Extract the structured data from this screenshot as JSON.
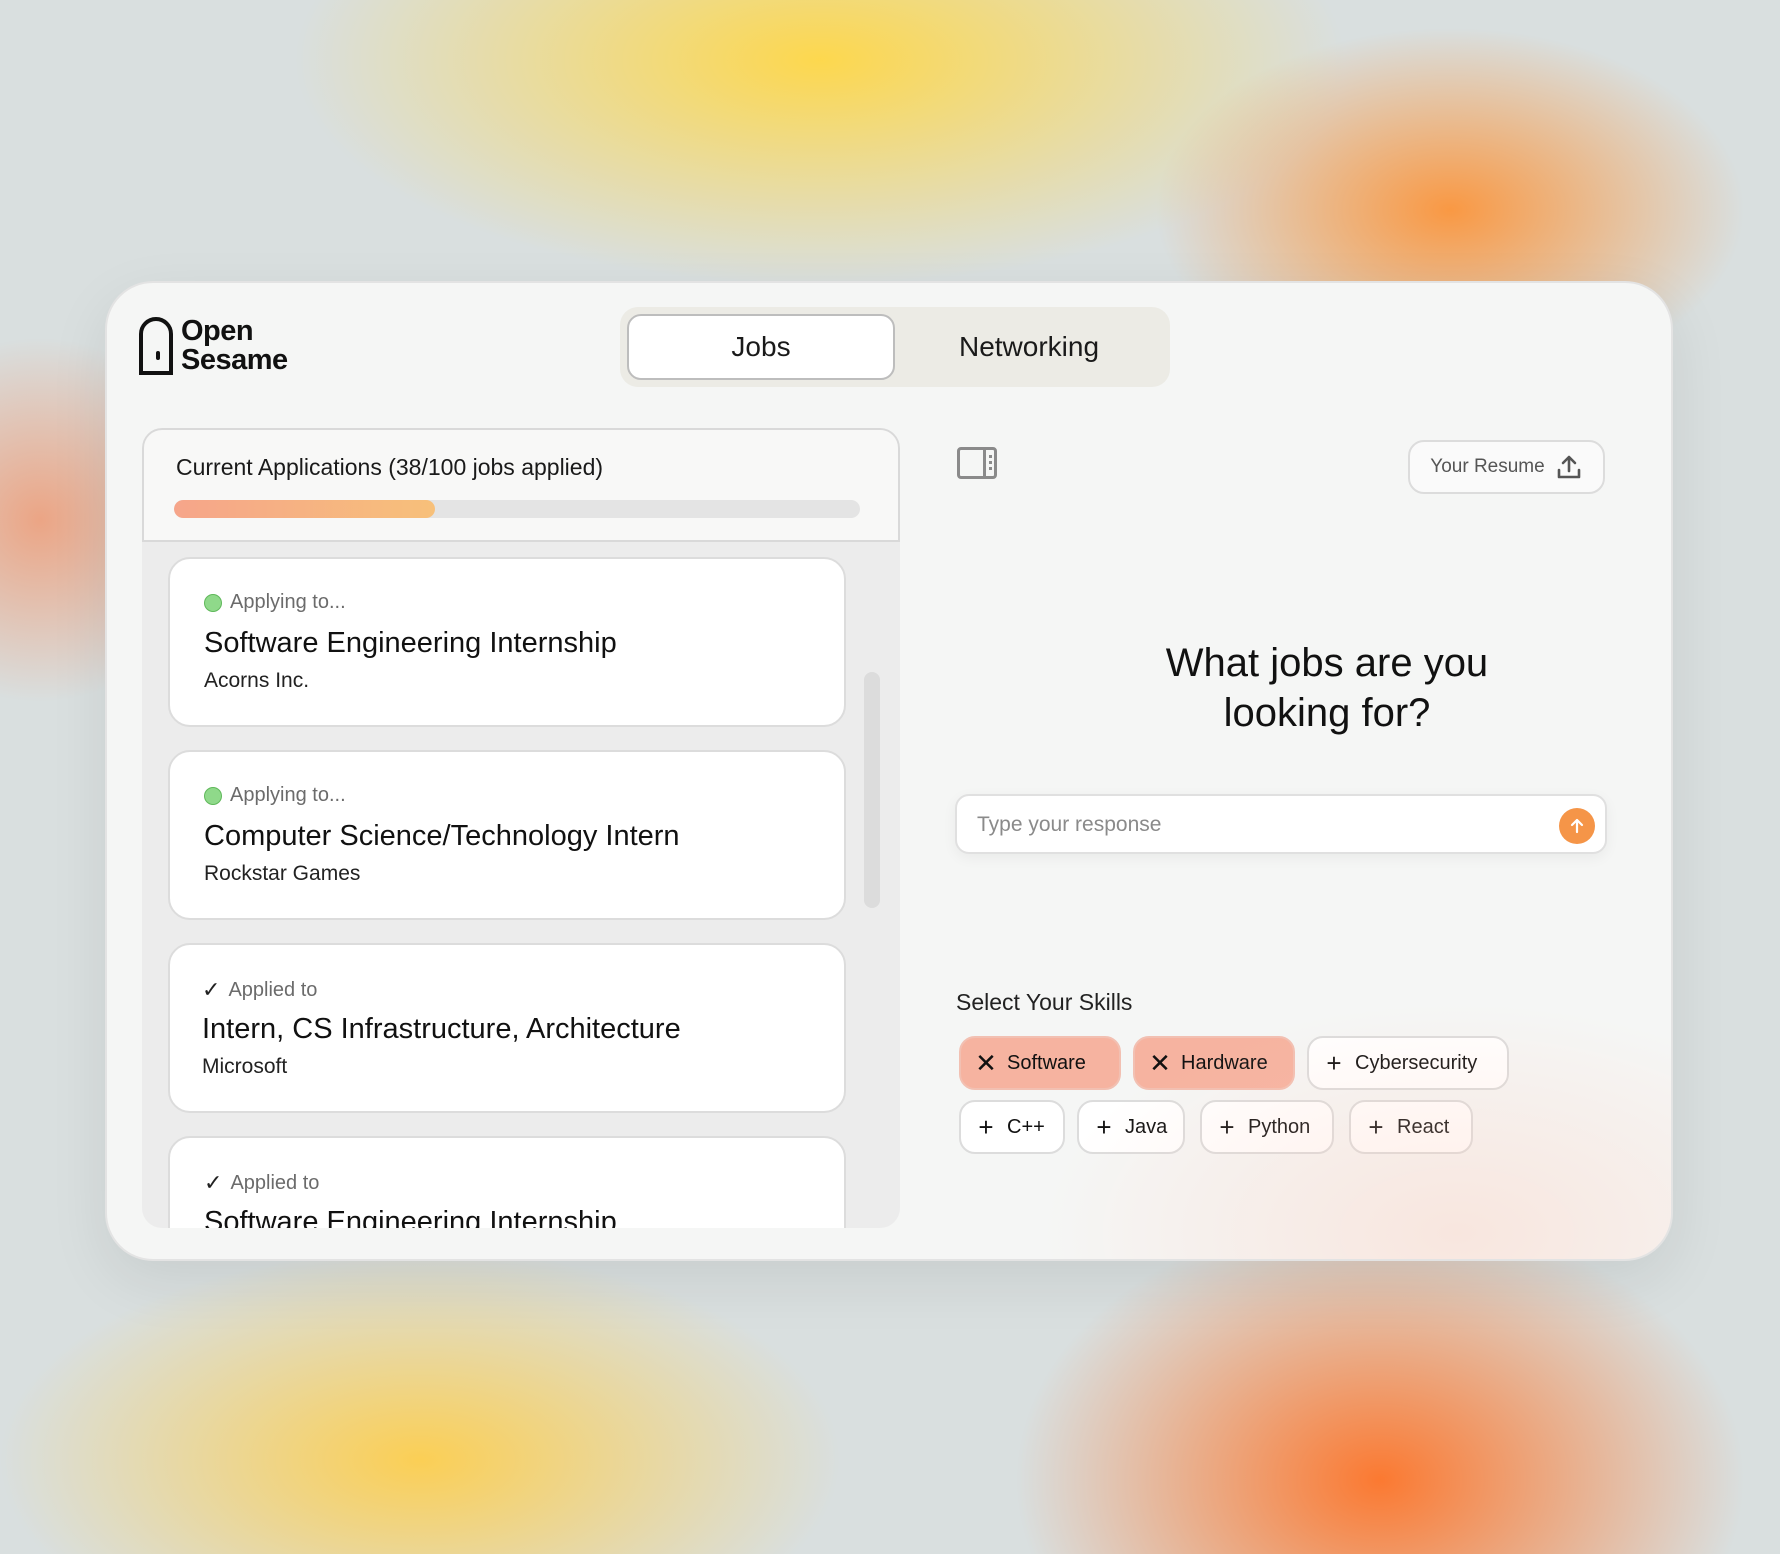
{
  "app": {
    "logo_line1": "Open",
    "logo_line2": "Sesame"
  },
  "tabs": [
    {
      "label": "Jobs",
      "active": true
    },
    {
      "label": "Networking",
      "active": false
    }
  ],
  "applications": {
    "title": "Current Applications (38/100 jobs applied)",
    "progress": 0.38,
    "jobs": [
      {
        "status": "Applying to...",
        "status_type": "applying",
        "title": "Software Engineering Internship",
        "company": "Acorns Inc."
      },
      {
        "status": "Applying to...",
        "status_type": "applying",
        "title": "Computer Science/Technology Intern",
        "company": "Rockstar Games"
      },
      {
        "status": "Applied to",
        "status_type": "applied",
        "title": "Intern, CS Infrastructure, Architecture",
        "company": "Microsoft"
      },
      {
        "status": "Applied to",
        "status_type": "applied",
        "title": "Software Engineering Internship",
        "company": ""
      }
    ]
  },
  "resume_button": {
    "label": "Your Resume",
    "icon": "upload-icon"
  },
  "prompt": {
    "headline_line1": "What jobs are you",
    "headline_line2": "looking for?",
    "placeholder": "Type your response",
    "value": ""
  },
  "skills": {
    "label": "Select Your Skills",
    "chips": [
      {
        "label": "Software",
        "selected": true
      },
      {
        "label": "Hardware",
        "selected": true
      },
      {
        "label": "Cybersecurity",
        "selected": false
      },
      {
        "label": "C++",
        "selected": false
      },
      {
        "label": "Java",
        "selected": false
      },
      {
        "label": "Python",
        "selected": false
      },
      {
        "label": "React",
        "selected": false
      }
    ]
  },
  "colors": {
    "accent": "#f59548",
    "chip_selected": "#f6b3a0",
    "status_dot": "#8fd98a"
  }
}
